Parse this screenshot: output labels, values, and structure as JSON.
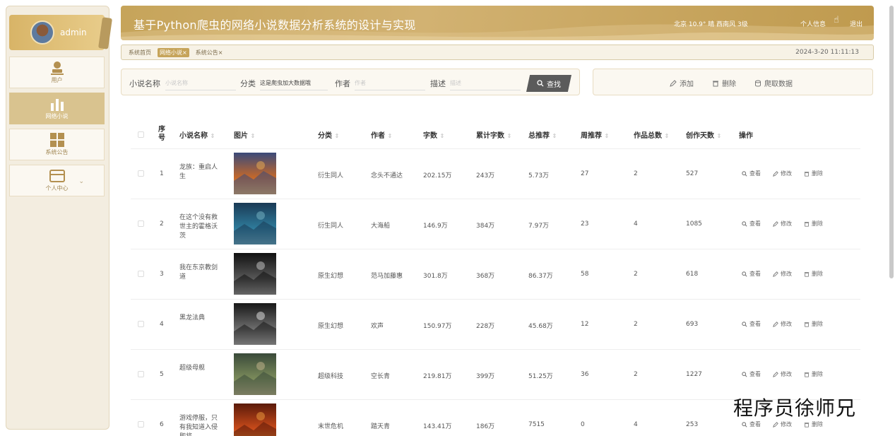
{
  "user": {
    "name": "admin"
  },
  "sidebar": {
    "items": [
      {
        "label": "用户",
        "icon": "user-icon",
        "active": false
      },
      {
        "label": "网络小说",
        "icon": "bar-chart-icon",
        "active": true
      },
      {
        "label": "系统公告",
        "icon": "grid-icon",
        "active": false
      },
      {
        "label": "个人中心",
        "icon": "card-icon",
        "active": false,
        "arrow": "⌄"
      }
    ]
  },
  "header": {
    "title": "基于Python爬虫的网络小说数据分析系统的设计与实现",
    "weather": "北京  10.9°  晴  西南风  3级",
    "profile_link": "个人信息",
    "logout_link": "退出"
  },
  "tabs": {
    "items": [
      {
        "label": "系统首页",
        "active": false
      },
      {
        "label": "网络小说×",
        "active": true
      },
      {
        "label": "系统公告×",
        "active": false
      }
    ],
    "time": "2024-3-20 11:11:13"
  },
  "search": {
    "name_label": "小说名称",
    "name_placeholder": "小说名称",
    "category_label": "分类",
    "category_value": "这是爬虫加大数据哦",
    "author_label": "作者",
    "author_placeholder": "作者",
    "desc_label": "描述",
    "desc_placeholder": "描述",
    "button": "查找"
  },
  "actions": {
    "add": "添加",
    "delete": "删除",
    "crawl": "爬取数据"
  },
  "table": {
    "columns": {
      "index": "序号",
      "name": "小说名称",
      "image": "图片",
      "category": "分类",
      "author": "作者",
      "words": "字数",
      "total_words": "累计字数",
      "total_rec": "总推荐",
      "week_rec": "周推荐",
      "works": "作品总数",
      "days": "创作天数",
      "ops": "操作"
    },
    "sort_marker": "⇕",
    "op_view": "查看",
    "op_edit": "修改",
    "op_delete": "删除",
    "rows": [
      {
        "index": "1",
        "name": "龙族：重启人生",
        "category": "衍生同人",
        "author": "念头不通达",
        "words": "202.15万",
        "total_words": "243万",
        "total_rec": "5.73万",
        "week_rec": "27",
        "works": "2",
        "days": "527",
        "cover": [
          "#3a4a7a",
          "#c4682a",
          "#f0b050"
        ]
      },
      {
        "index": "2",
        "name": "在这个没有救世主的霍格沃茨",
        "category": "衍生同人",
        "author": "大海船",
        "words": "146.9万",
        "total_words": "384万",
        "total_rec": "7.97万",
        "week_rec": "23",
        "works": "4",
        "days": "1085",
        "cover": [
          "#1a3a55",
          "#2e7a9a",
          "#7ab8c8"
        ]
      },
      {
        "index": "3",
        "name": "我在东京教剑道",
        "category": "原生幻想",
        "author": "范马加藤惠",
        "words": "301.8万",
        "total_words": "368万",
        "total_rec": "86.37万",
        "week_rec": "58",
        "works": "2",
        "days": "618",
        "cover": [
          "#111111",
          "#555555",
          "#cccccc"
        ]
      },
      {
        "index": "4",
        "name": "黑龙法典",
        "category": "原生幻想",
        "author": "欢声",
        "words": "150.97万",
        "total_words": "228万",
        "total_rec": "45.68万",
        "week_rec": "12",
        "works": "2",
        "days": "693",
        "cover": [
          "#181818",
          "#6a6a6a",
          "#e8e8e8"
        ]
      },
      {
        "index": "5",
        "name": "超级母舰",
        "category": "超级科技",
        "author": "空长青",
        "words": "219.81万",
        "total_words": "399万",
        "total_rec": "51.25万",
        "week_rec": "36",
        "works": "2",
        "days": "1227",
        "cover": [
          "#3a4a3a",
          "#7a8a5a",
          "#c8b890"
        ]
      },
      {
        "index": "6",
        "name": "游戏停服，只有我知道入侵即将",
        "category": "末世危机",
        "author": "踏天青",
        "words": "143.41万",
        "total_words": "186万",
        "total_rec": "7515",
        "week_rec": "0",
        "works": "4",
        "days": "253",
        "cover": [
          "#5a1a0a",
          "#c84a1a",
          "#f0a040"
        ]
      }
    ]
  },
  "watermark": "程序员徐师兄",
  "colors": {
    "accent": "#c6a45a",
    "sidebar_bg": "#f3ede0",
    "active_nav": "#d9c38f"
  }
}
